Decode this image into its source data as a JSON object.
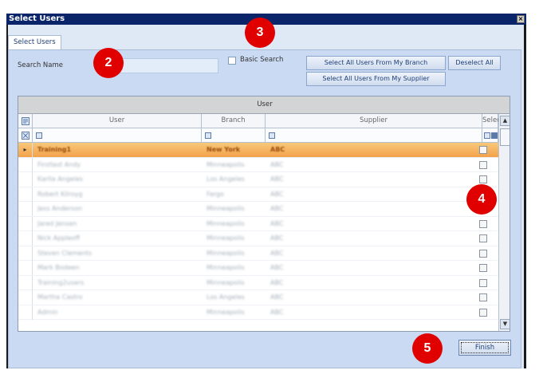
{
  "window": {
    "title": "Select Users",
    "close_glyph": "×"
  },
  "tabs": [
    {
      "label": "Select Users"
    }
  ],
  "search": {
    "label": "Search Name",
    "value": ""
  },
  "basic_search": {
    "label": "Basic Search",
    "checked": false
  },
  "buttons": {
    "select_all_branch": "Select All Users From My Branch",
    "select_all_supplier": "Select All Users From My Supplier",
    "deselect_all": "Deselect All",
    "finish": "Finish"
  },
  "grid": {
    "group_header": "User",
    "columns": [
      "User",
      "Branch",
      "Supplier",
      "Select"
    ],
    "rows": [
      {
        "user": "Training1",
        "branch": "New York",
        "supplier": "ABC",
        "selected": true
      },
      {
        "user": "Firstlast Andy",
        "branch": "Minneapolis",
        "supplier": "ABC",
        "selected": false
      },
      {
        "user": "Karlla Angeles",
        "branch": "Los Angeles",
        "supplier": "ABC",
        "selected": false
      },
      {
        "user": "Robert Kilroyg",
        "branch": "Fargo",
        "supplier": "ABC",
        "selected": false
      },
      {
        "user": "Jess Anderson",
        "branch": "Minneapolis",
        "supplier": "ABC",
        "selected": false
      },
      {
        "user": "Jared Jensen",
        "branch": "Minneapolis",
        "supplier": "ABC",
        "selected": false
      },
      {
        "user": "Nick Appleoff",
        "branch": "Minneapolis",
        "supplier": "ABC",
        "selected": false
      },
      {
        "user": "Steven Clements",
        "branch": "Minneapolis",
        "supplier": "ABC",
        "selected": false
      },
      {
        "user": "Mark Bodeen",
        "branch": "Minneapolis",
        "supplier": "ABC",
        "selected": false
      },
      {
        "user": "Training2users",
        "branch": "Minneapolis",
        "supplier": "ABC",
        "selected": false
      },
      {
        "user": "Martha Castro",
        "branch": "Los Angeles",
        "supplier": "ABC",
        "selected": false
      },
      {
        "user": "Admin",
        "branch": "Minneapolis",
        "supplier": "ABC",
        "selected": false
      }
    ]
  },
  "callouts": [
    "2",
    "3",
    "4",
    "5"
  ],
  "icons": {
    "column_chooser": "column-chooser-icon",
    "filter_clear": "filter-clear-icon",
    "filter": "filter-icon",
    "row_pointer": "▸",
    "scroll_up": "▲",
    "scroll_down": "▼"
  },
  "colors": {
    "title_bar": "#0a246a",
    "selected_row": "#f3a24a",
    "callout": "#e00000",
    "panel": "#c9daf2"
  }
}
